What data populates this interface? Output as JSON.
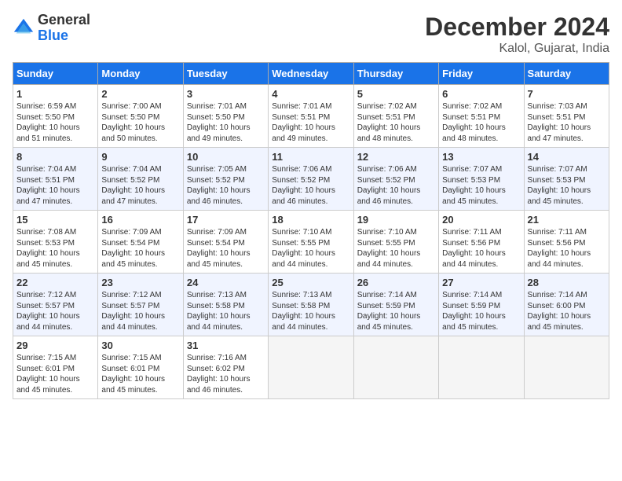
{
  "logo": {
    "general": "General",
    "blue": "Blue"
  },
  "title": "December 2024",
  "location": "Kalol, Gujarat, India",
  "weekdays": [
    "Sunday",
    "Monday",
    "Tuesday",
    "Wednesday",
    "Thursday",
    "Friday",
    "Saturday"
  ],
  "weeks": [
    [
      {
        "day": "1",
        "info": "Sunrise: 6:59 AM\nSunset: 5:50 PM\nDaylight: 10 hours\nand 51 minutes."
      },
      {
        "day": "2",
        "info": "Sunrise: 7:00 AM\nSunset: 5:50 PM\nDaylight: 10 hours\nand 50 minutes."
      },
      {
        "day": "3",
        "info": "Sunrise: 7:01 AM\nSunset: 5:50 PM\nDaylight: 10 hours\nand 49 minutes."
      },
      {
        "day": "4",
        "info": "Sunrise: 7:01 AM\nSunset: 5:51 PM\nDaylight: 10 hours\nand 49 minutes."
      },
      {
        "day": "5",
        "info": "Sunrise: 7:02 AM\nSunset: 5:51 PM\nDaylight: 10 hours\nand 48 minutes."
      },
      {
        "day": "6",
        "info": "Sunrise: 7:02 AM\nSunset: 5:51 PM\nDaylight: 10 hours\nand 48 minutes."
      },
      {
        "day": "7",
        "info": "Sunrise: 7:03 AM\nSunset: 5:51 PM\nDaylight: 10 hours\nand 47 minutes."
      }
    ],
    [
      {
        "day": "8",
        "info": "Sunrise: 7:04 AM\nSunset: 5:51 PM\nDaylight: 10 hours\nand 47 minutes."
      },
      {
        "day": "9",
        "info": "Sunrise: 7:04 AM\nSunset: 5:52 PM\nDaylight: 10 hours\nand 47 minutes."
      },
      {
        "day": "10",
        "info": "Sunrise: 7:05 AM\nSunset: 5:52 PM\nDaylight: 10 hours\nand 46 minutes."
      },
      {
        "day": "11",
        "info": "Sunrise: 7:06 AM\nSunset: 5:52 PM\nDaylight: 10 hours\nand 46 minutes."
      },
      {
        "day": "12",
        "info": "Sunrise: 7:06 AM\nSunset: 5:52 PM\nDaylight: 10 hours\nand 46 minutes."
      },
      {
        "day": "13",
        "info": "Sunrise: 7:07 AM\nSunset: 5:53 PM\nDaylight: 10 hours\nand 45 minutes."
      },
      {
        "day": "14",
        "info": "Sunrise: 7:07 AM\nSunset: 5:53 PM\nDaylight: 10 hours\nand 45 minutes."
      }
    ],
    [
      {
        "day": "15",
        "info": "Sunrise: 7:08 AM\nSunset: 5:53 PM\nDaylight: 10 hours\nand 45 minutes."
      },
      {
        "day": "16",
        "info": "Sunrise: 7:09 AM\nSunset: 5:54 PM\nDaylight: 10 hours\nand 45 minutes."
      },
      {
        "day": "17",
        "info": "Sunrise: 7:09 AM\nSunset: 5:54 PM\nDaylight: 10 hours\nand 45 minutes."
      },
      {
        "day": "18",
        "info": "Sunrise: 7:10 AM\nSunset: 5:55 PM\nDaylight: 10 hours\nand 44 minutes."
      },
      {
        "day": "19",
        "info": "Sunrise: 7:10 AM\nSunset: 5:55 PM\nDaylight: 10 hours\nand 44 minutes."
      },
      {
        "day": "20",
        "info": "Sunrise: 7:11 AM\nSunset: 5:56 PM\nDaylight: 10 hours\nand 44 minutes."
      },
      {
        "day": "21",
        "info": "Sunrise: 7:11 AM\nSunset: 5:56 PM\nDaylight: 10 hours\nand 44 minutes."
      }
    ],
    [
      {
        "day": "22",
        "info": "Sunrise: 7:12 AM\nSunset: 5:57 PM\nDaylight: 10 hours\nand 44 minutes."
      },
      {
        "day": "23",
        "info": "Sunrise: 7:12 AM\nSunset: 5:57 PM\nDaylight: 10 hours\nand 44 minutes."
      },
      {
        "day": "24",
        "info": "Sunrise: 7:13 AM\nSunset: 5:58 PM\nDaylight: 10 hours\nand 44 minutes."
      },
      {
        "day": "25",
        "info": "Sunrise: 7:13 AM\nSunset: 5:58 PM\nDaylight: 10 hours\nand 44 minutes."
      },
      {
        "day": "26",
        "info": "Sunrise: 7:14 AM\nSunset: 5:59 PM\nDaylight: 10 hours\nand 45 minutes."
      },
      {
        "day": "27",
        "info": "Sunrise: 7:14 AM\nSunset: 5:59 PM\nDaylight: 10 hours\nand 45 minutes."
      },
      {
        "day": "28",
        "info": "Sunrise: 7:14 AM\nSunset: 6:00 PM\nDaylight: 10 hours\nand 45 minutes."
      }
    ],
    [
      {
        "day": "29",
        "info": "Sunrise: 7:15 AM\nSunset: 6:01 PM\nDaylight: 10 hours\nand 45 minutes."
      },
      {
        "day": "30",
        "info": "Sunrise: 7:15 AM\nSunset: 6:01 PM\nDaylight: 10 hours\nand 45 minutes."
      },
      {
        "day": "31",
        "info": "Sunrise: 7:16 AM\nSunset: 6:02 PM\nDaylight: 10 hours\nand 46 minutes."
      },
      null,
      null,
      null,
      null
    ]
  ]
}
